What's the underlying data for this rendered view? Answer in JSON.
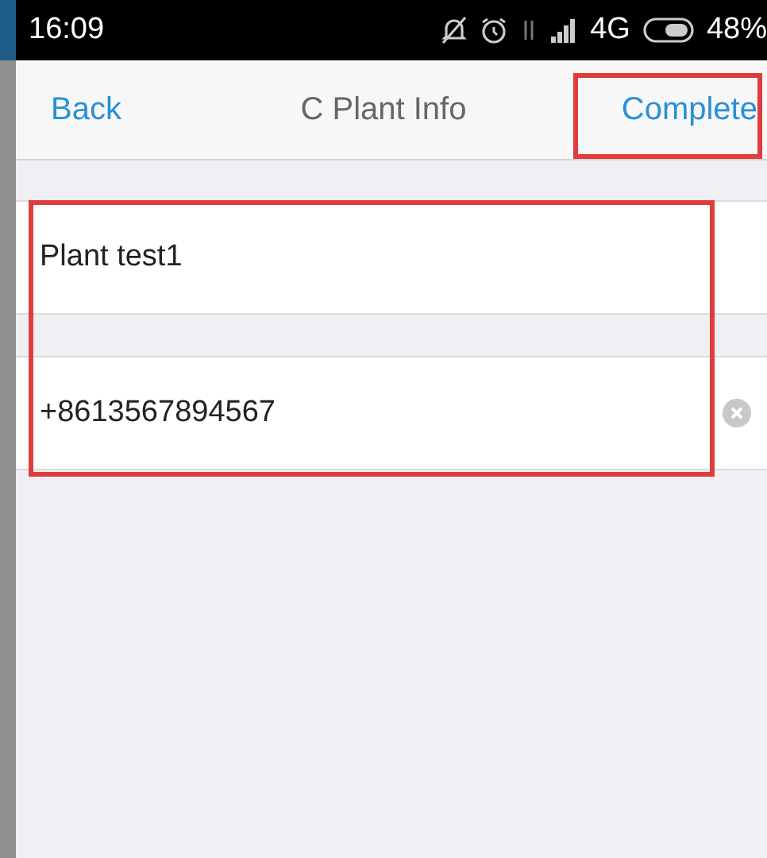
{
  "status_bar": {
    "time": "16:09",
    "network": "4G",
    "battery": "48%"
  },
  "nav": {
    "back": "Back",
    "title": "C Plant Info",
    "action": "Complete"
  },
  "fields": [
    {
      "value": "Plant test1",
      "clearable": false
    },
    {
      "value": "+8613567894567",
      "clearable": true
    }
  ],
  "highlights": {
    "action": true,
    "fields": true
  }
}
